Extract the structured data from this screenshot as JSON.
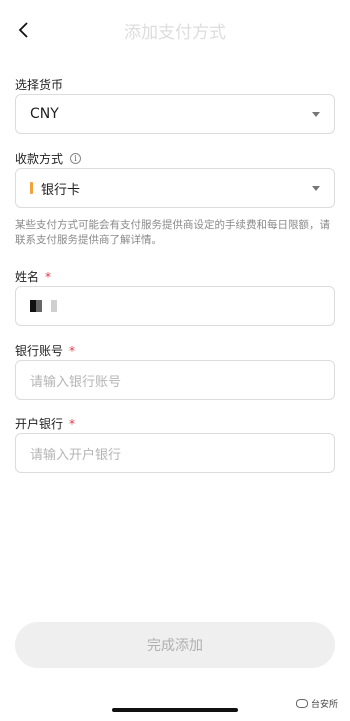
{
  "header": {
    "title": "添加支付方式"
  },
  "currency": {
    "label": "选择货币",
    "value": "CNY"
  },
  "payment_method": {
    "label": "收款方式",
    "value": "银行卡",
    "accent_color": "#f0a23b"
  },
  "note": "某些支付方式可能会有支付服务提供商设定的手续费和每日限额，请联系支付服务提供商了解详情。",
  "name": {
    "label": "姓名",
    "required_mark": "*"
  },
  "account": {
    "label": "银行账号",
    "required_mark": "*",
    "placeholder": "请输入银行账号"
  },
  "bank": {
    "label": "开户银行",
    "required_mark": "*",
    "placeholder": "请输入开户银行"
  },
  "submit": {
    "label": "完成添加"
  },
  "watermark": {
    "text": "台安所"
  },
  "colors": {
    "required": "#e0394b",
    "border": "#dcdcdc",
    "button_bg": "#efefef"
  }
}
